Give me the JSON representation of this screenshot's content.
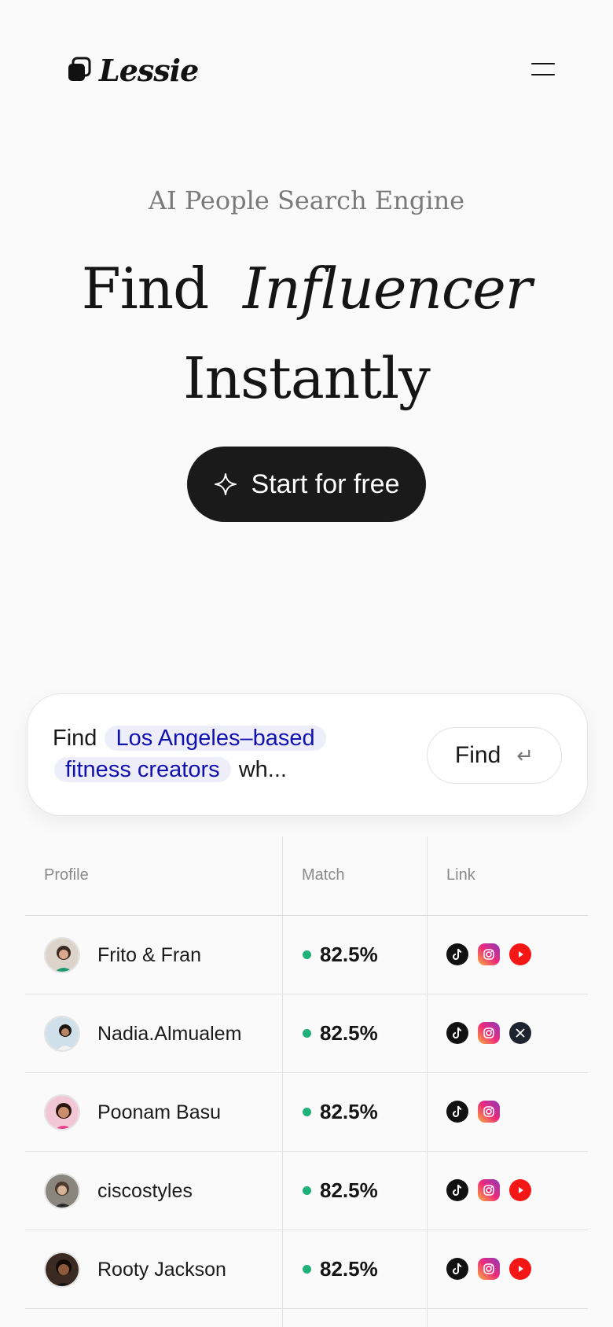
{
  "header": {
    "logo_text": "Lessie",
    "menu_icon": "hamburger-menu-icon"
  },
  "hero": {
    "eyebrow": "AI People Search Engine",
    "headline_part1": "Find",
    "headline_highlight": "Influencer",
    "headline_part2": "Instantly",
    "cta_label": "Start for free",
    "cta_icon": "sparkle-icon"
  },
  "search": {
    "prefix": "Find",
    "chip1": "Los Angeles–based",
    "chip2": "fitness creators",
    "suffix": "wh...",
    "button_label": "Find",
    "button_icon": "enter-icon"
  },
  "table": {
    "columns": [
      "Profile",
      "Match",
      "Link"
    ],
    "rows": [
      {
        "name": "Frito & Fran",
        "match": "82.5%",
        "links": [
          "tiktok",
          "instagram",
          "youtube"
        ]
      },
      {
        "name": "Nadia.Almualem",
        "match": "82.5%",
        "links": [
          "tiktok",
          "instagram",
          "x"
        ]
      },
      {
        "name": "Poonam Basu",
        "match": "82.5%",
        "links": [
          "tiktok",
          "instagram"
        ]
      },
      {
        "name": "ciscostyles",
        "match": "82.5%",
        "links": [
          "tiktok",
          "instagram",
          "youtube"
        ]
      },
      {
        "name": "Rooty Jackson",
        "match": "82.5%",
        "links": [
          "tiktok",
          "instagram",
          "youtube"
        ]
      }
    ]
  },
  "colors": {
    "accent_dark": "#1a1a1a",
    "chip_bg": "#eeeefa",
    "chip_text": "#1111b0",
    "match_dot": "#20b07a"
  }
}
